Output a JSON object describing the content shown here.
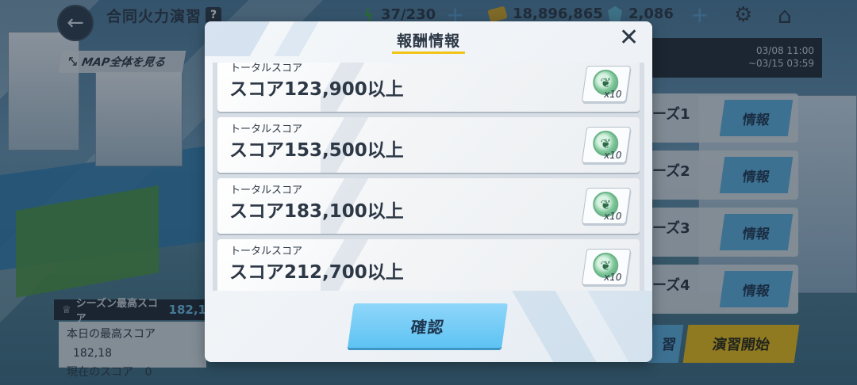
{
  "header": {
    "title": "合同火力演習",
    "help_label": "?",
    "stamina": "37/230",
    "coins": "18,896,865",
    "gems": "2,086",
    "plus": "+"
  },
  "map_button": {
    "label": "MAP全体を見る"
  },
  "period": {
    "start": "03/08 11:00",
    "end": "~03/15 03:59"
  },
  "phases": [
    {
      "label": "ーズ1",
      "button": "情報"
    },
    {
      "label": "ーズ2",
      "button": "情報"
    },
    {
      "label": "ーズ3",
      "button": "情報"
    },
    {
      "label": "ーズ4",
      "button": "情報"
    }
  ],
  "bottom_buttons": {
    "partial_label": "習",
    "start_label": "演習開始"
  },
  "score_panel": {
    "season_label": "シーズン最高スコア",
    "season_value": "182,1",
    "today_label": "本日の最高スコア",
    "today_value": "182,18",
    "current_label": "現在のスコア",
    "current_value": "0"
  },
  "modal": {
    "title": "報酬情報",
    "confirm_label": "確認",
    "rewards": [
      {
        "caption": "トータルスコア",
        "score": "スコア123,900以上",
        "qty": "x10"
      },
      {
        "caption": "トータルスコア",
        "score": "スコア153,500以上",
        "qty": "x10"
      },
      {
        "caption": "トータルスコア",
        "score": "スコア183,100以上",
        "qty": "x10"
      },
      {
        "caption": "トータルスコア",
        "score": "スコア212,700以上",
        "qty": "x10"
      }
    ]
  },
  "colors": {
    "accent": "#5ec3f3",
    "underline": "#f2c417",
    "start_button": "#f4c319"
  }
}
